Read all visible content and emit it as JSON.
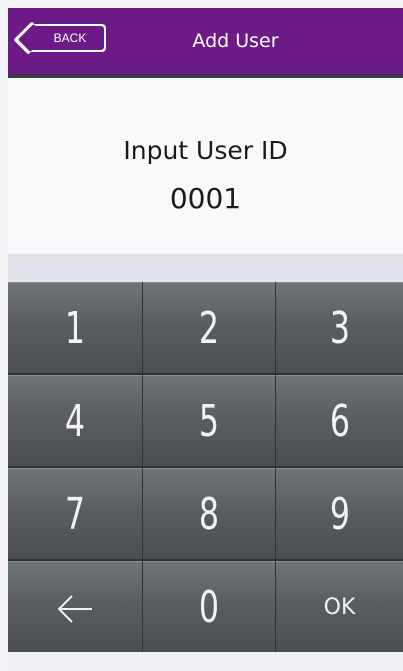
{
  "header": {
    "back_label": "BACK",
    "title": "Add User",
    "color": "#6c1a86"
  },
  "prompt": {
    "label": "Input User ID",
    "value": "0001"
  },
  "keypad": {
    "keys": [
      {
        "label": "1",
        "kind": "digit"
      },
      {
        "label": "2",
        "kind": "digit"
      },
      {
        "label": "3",
        "kind": "digit"
      },
      {
        "label": "4",
        "kind": "digit"
      },
      {
        "label": "5",
        "kind": "digit"
      },
      {
        "label": "6",
        "kind": "digit"
      },
      {
        "label": "7",
        "kind": "digit"
      },
      {
        "label": "8",
        "kind": "digit"
      },
      {
        "label": "9",
        "kind": "digit"
      },
      {
        "label": "←",
        "kind": "backspace",
        "icon": "arrow-left-icon"
      },
      {
        "label": "0",
        "kind": "digit"
      },
      {
        "label": "OK",
        "kind": "ok"
      }
    ]
  }
}
